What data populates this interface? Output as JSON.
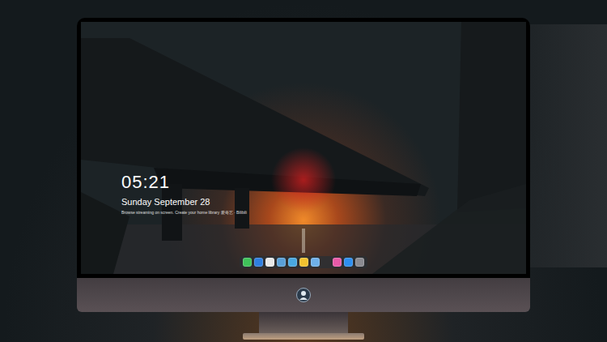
{
  "lock_screen": {
    "time": "05:21",
    "date": "Sunday September 28",
    "tagline": "Browse streaming on screen. Create your home library 爱奇艺 · Bilibili"
  },
  "dock": {
    "pinned": [
      {
        "color": "#3fc35a"
      },
      {
        "color": "#2f7fe0"
      },
      {
        "color": "#e8e8e8"
      },
      {
        "color": "#5aa0d8"
      },
      {
        "color": "#4aa8e0"
      },
      {
        "color": "#f2c230"
      },
      {
        "color": "#6fb0e8"
      }
    ],
    "recent": [
      {
        "color": "#e85aa8"
      },
      {
        "color": "#2e8ff0"
      },
      {
        "color": "#8a8a90"
      }
    ]
  }
}
